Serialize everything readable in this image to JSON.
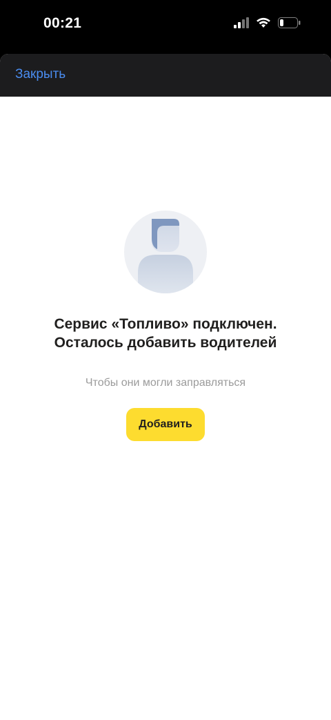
{
  "status_bar": {
    "time": "00:21",
    "icons": [
      "cellular-signal-icon",
      "wifi-icon",
      "battery-icon"
    ]
  },
  "nav": {
    "close_label": "Закрыть"
  },
  "empty_state": {
    "avatar_icon": "person-placeholder-icon",
    "title": "Сервис «Топливо» подключен. Осталось добавить водителей",
    "subtitle": "Чтобы они могли заправляться",
    "button_label": "Добавить"
  },
  "colors": {
    "accent_link": "#4a8cf0",
    "button_yellow": "#fddc2f",
    "nav_background": "#1c1c1e",
    "text_primary": "#21201f",
    "text_secondary": "#9a9a9a"
  }
}
